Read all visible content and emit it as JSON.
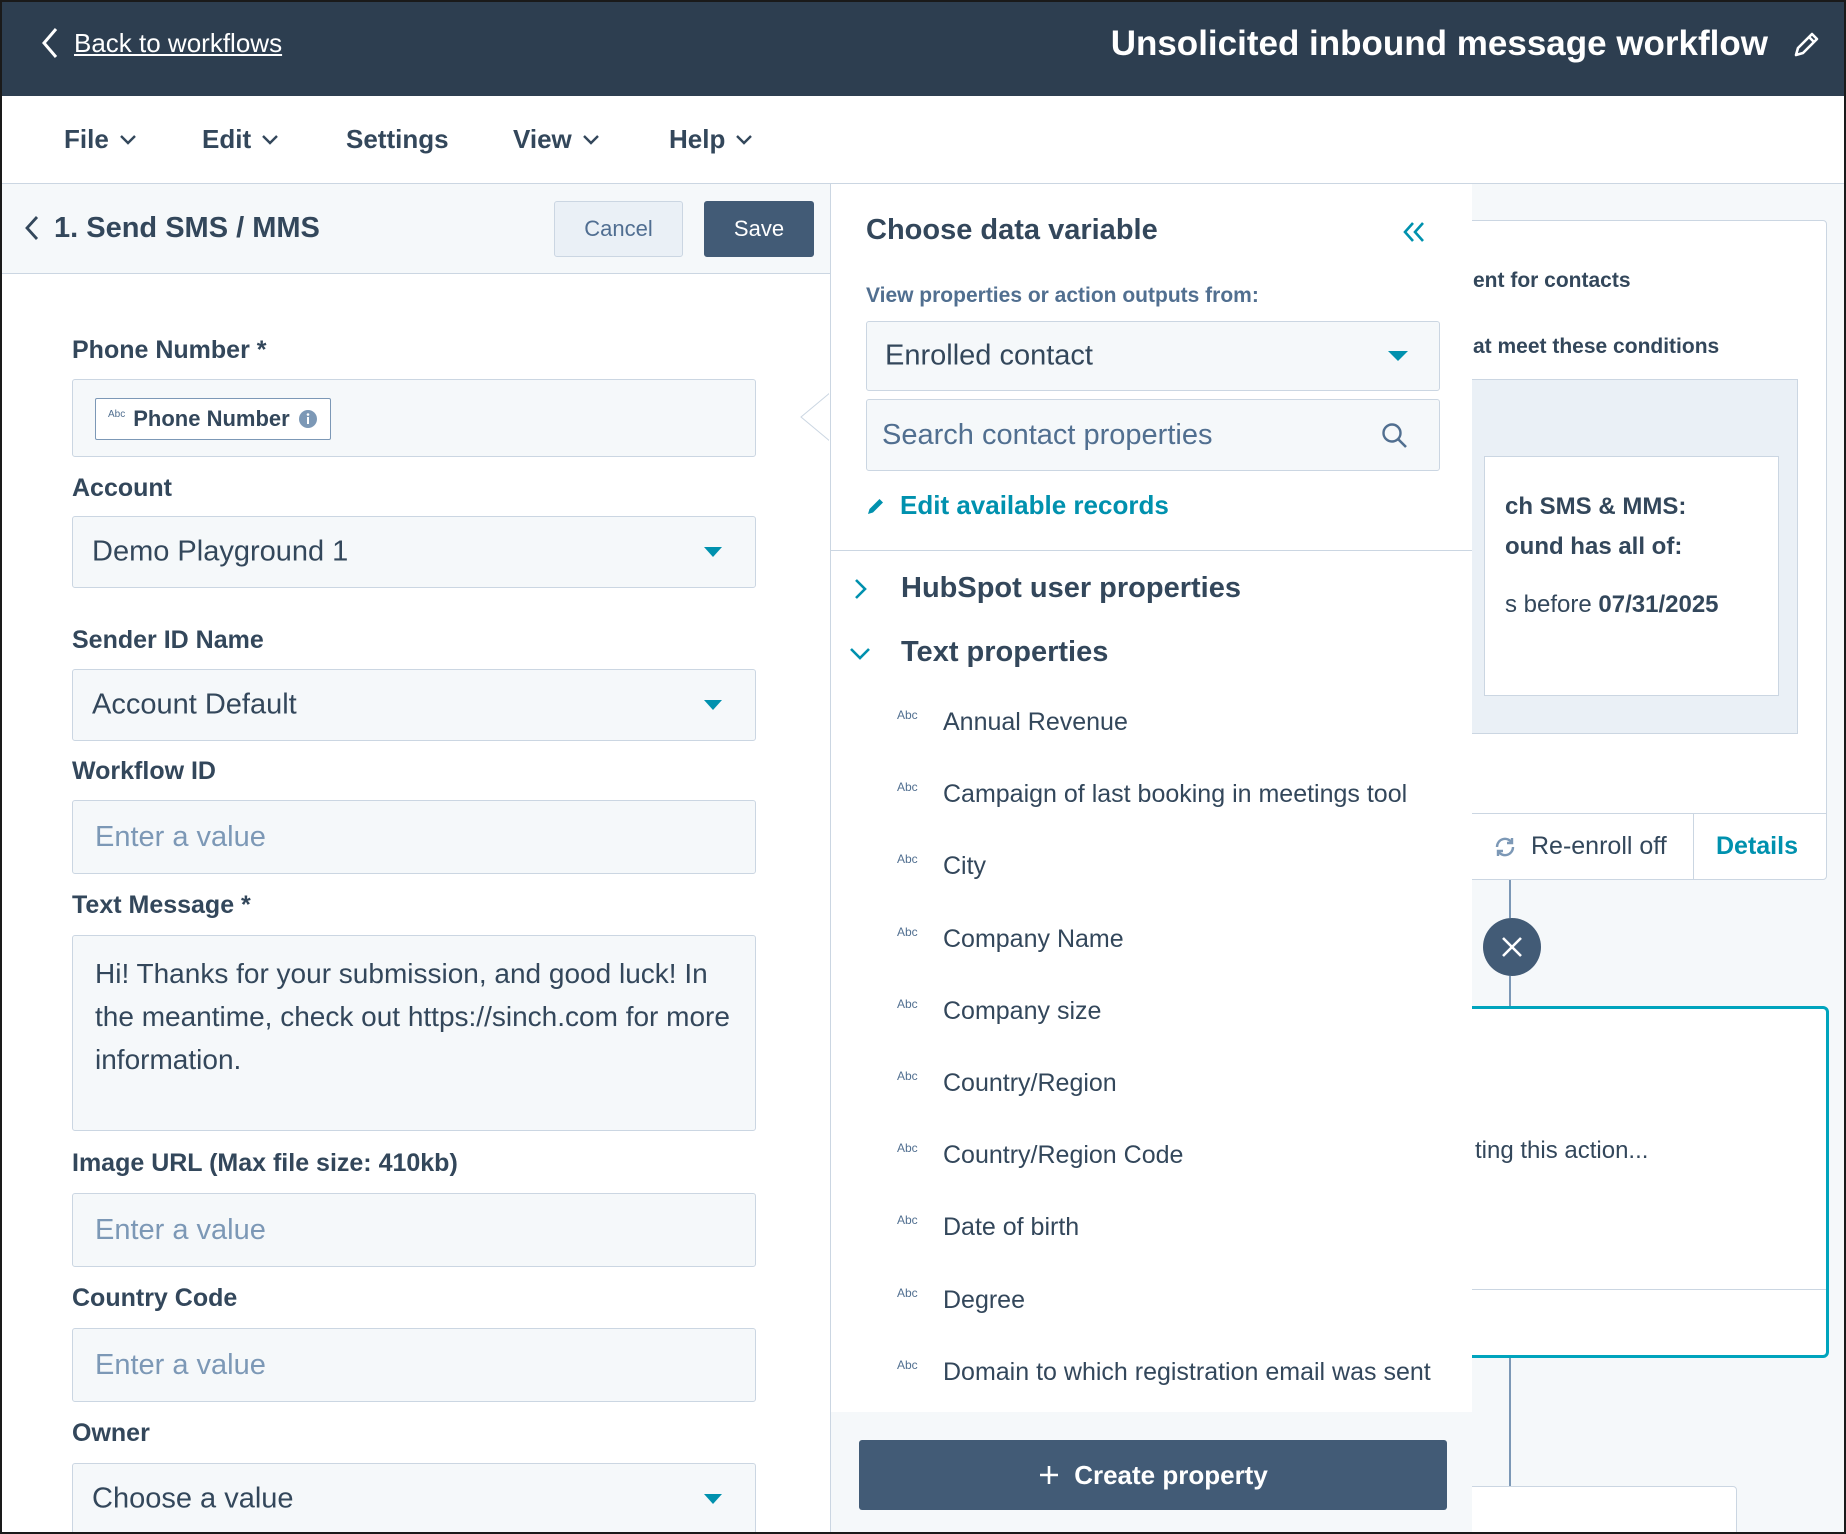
{
  "header": {
    "back_label": "Back to workflows",
    "workflow_title": "Unsolicited inbound message workflow"
  },
  "menu": {
    "items": [
      {
        "label": "File",
        "has_dropdown": true
      },
      {
        "label": "Edit",
        "has_dropdown": true
      },
      {
        "label": "Settings",
        "has_dropdown": false
      },
      {
        "label": "View",
        "has_dropdown": true
      },
      {
        "label": "Help",
        "has_dropdown": true
      }
    ]
  },
  "action_panel": {
    "title": "1. Send SMS / MMS",
    "cancel_label": "Cancel",
    "save_label": "Save",
    "fields": {
      "phone_number": {
        "label": "Phone Number *",
        "token_type": "Abc",
        "token_label": "Phone Number"
      },
      "account": {
        "label": "Account",
        "value": "Demo Playground 1"
      },
      "sender_id": {
        "label": "Sender ID Name",
        "value": "Account Default"
      },
      "workflow_id": {
        "label": "Workflow ID",
        "placeholder": "Enter a value"
      },
      "text_message": {
        "label": "Text Message *",
        "value": "Hi! Thanks for your submission, and good luck! In the meantime, check out https://sinch.com for more information."
      },
      "image_url": {
        "label": "Image URL (Max file size: 410kb)",
        "placeholder": "Enter a value"
      },
      "country_code": {
        "label": "Country Code",
        "placeholder": "Enter a value"
      },
      "owner": {
        "label": "Owner",
        "value": "Choose a value"
      }
    }
  },
  "variable_panel": {
    "title": "Choose data variable",
    "view_from_label": "View properties or action outputs from:",
    "source_value": "Enrolled contact",
    "search_placeholder": "Search contact properties",
    "edit_records_label": "Edit available records",
    "groups": [
      {
        "label": "HubSpot user properties",
        "expanded": false
      },
      {
        "label": "Text properties",
        "expanded": true
      }
    ],
    "type_badge": "Abc",
    "properties": [
      "Annual Revenue",
      "Campaign of last booking in meetings tool",
      "City",
      "Company Name",
      "Company size",
      "Country/Region",
      "Country/Region Code",
      "Date of birth",
      "Degree",
      "Domain to which registration email was sent"
    ],
    "create_label": "Create property"
  },
  "canvas": {
    "trigger_line1": "ent for contacts",
    "trigger_line2": "at meet these conditions",
    "condition_line1": "ch SMS & MMS:",
    "condition_line2": "ound has all of:",
    "condition_line3_prefix": "s before ",
    "condition_line3_date": "07/31/2025",
    "reenroll_label": "Re-enroll off",
    "details_label": "Details",
    "action_text": "ting this action..."
  },
  "colors": {
    "header_bg": "#2d3e50",
    "primary_button": "#425b76",
    "link": "#0091ae",
    "selected_border": "#00a4bd"
  }
}
